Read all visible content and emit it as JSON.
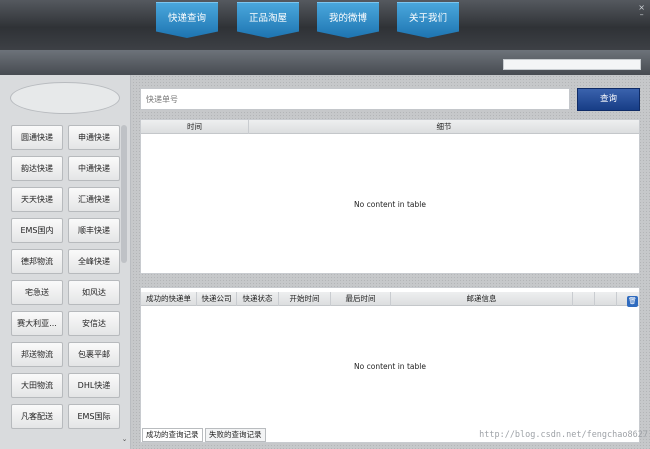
{
  "nav": {
    "items": [
      {
        "label": "快递查询"
      },
      {
        "label": "正品淘屋"
      },
      {
        "label": "我的微博"
      },
      {
        "label": "关于我们"
      }
    ]
  },
  "window": {
    "close": "×",
    "minimize": "–"
  },
  "sidebar": {
    "buttons": [
      "圆通快递",
      "申通快递",
      "韵达快递",
      "中通快递",
      "天天快递",
      "汇通快递",
      "EMS国内",
      "顺丰快递",
      "德邦物流",
      "全峰快递",
      "宅急送",
      "如风达",
      "赛大利亚...",
      "安信达",
      "邦送物流",
      "包裹平邮",
      "大田物流",
      "DHL快递",
      "凡客配送",
      "EMS国际"
    ]
  },
  "search": {
    "placeholder": "快递单号",
    "button": "查询"
  },
  "table1": {
    "columns": [
      "时间",
      "细节"
    ],
    "empty": "No content in table"
  },
  "table2": {
    "columns": [
      "成功的快递单",
      "快递公司",
      "快递状态",
      "开始时间",
      "最后时间",
      "邮递信息"
    ],
    "empty": "No content in table",
    "tabs": [
      "成功的查询记录",
      "失败的查询记录"
    ]
  },
  "watermark": "http://blog.csdn.net/fengchao8627"
}
